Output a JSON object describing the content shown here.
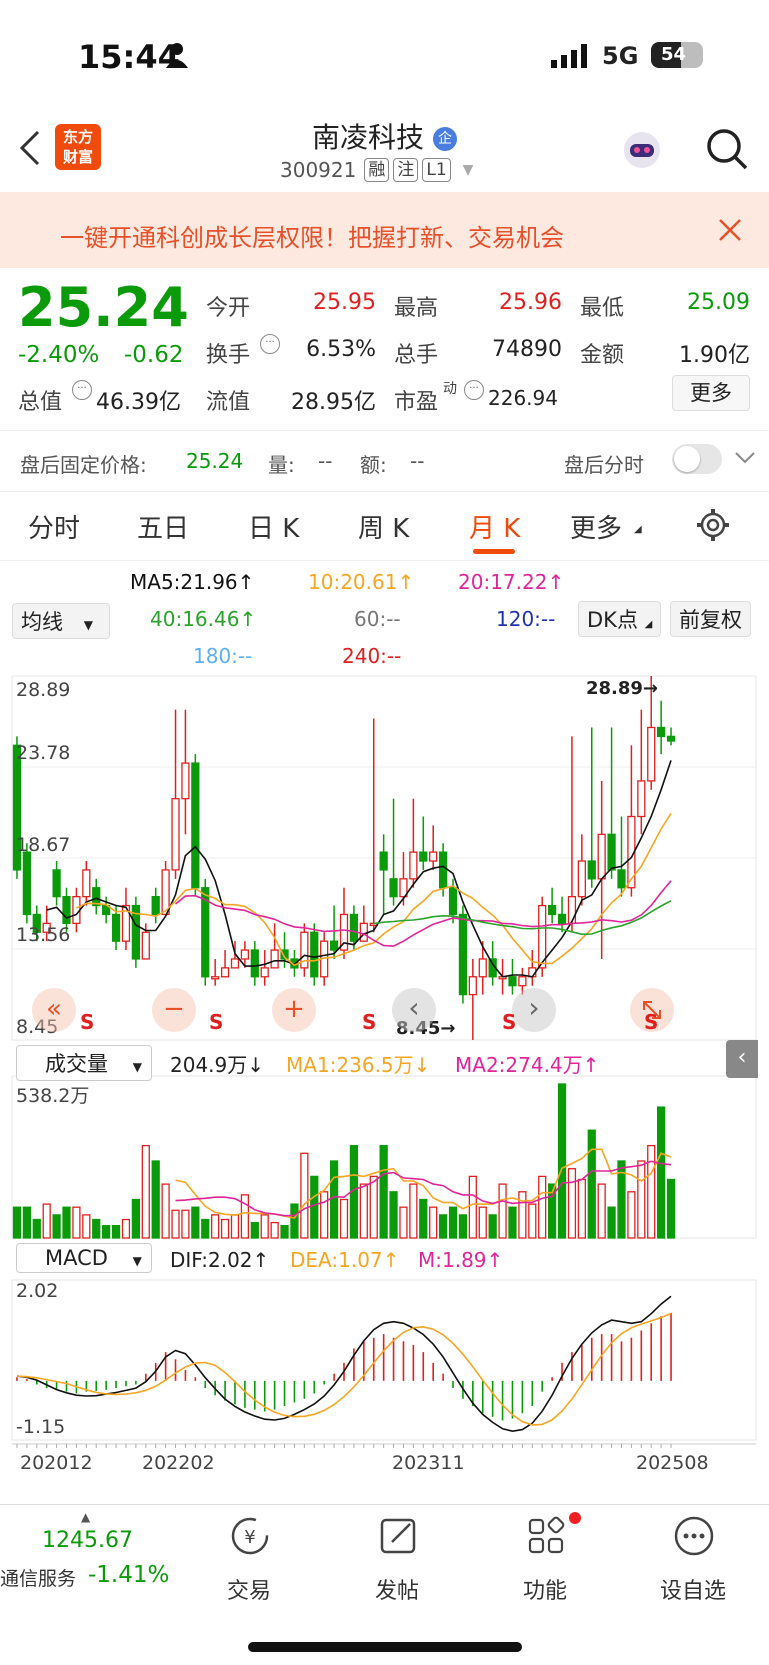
{
  "status_bar": {
    "time": "15:44",
    "network": "5G",
    "battery": "54"
  },
  "header": {
    "app_logo_line1": "东方",
    "app_logo_line2": "财富",
    "stock_name": "南凌科技",
    "enterprise_badge": "企",
    "stock_code": "300921",
    "tags": [
      "融",
      "注",
      "L1"
    ]
  },
  "banner": {
    "text": "一键开通科创成长层权限！把握打新、交易机会"
  },
  "quote": {
    "price": "25.24",
    "change_pct": "-2.40%",
    "change": "-0.62",
    "open_label": "今开",
    "open": "25.95",
    "high_label": "最高",
    "high": "25.96",
    "low_label": "最低",
    "low": "25.09",
    "turnover_label": "换手",
    "turnover": "6.53%",
    "volume_label": "总手",
    "volume": "74890",
    "amount_label": "金额",
    "amount": "1.90亿",
    "mktcap_label": "总值",
    "mktcap": "46.39亿",
    "float_label": "流值",
    "float_cap": "28.95亿",
    "pe_label": "市盈",
    "pe_sup": "动",
    "pe": "226.94",
    "more_label": "更多"
  },
  "after_hours": {
    "fixed_price_label": "盘后固定价格:",
    "fixed_price": "25.24",
    "vol_label": "量:",
    "vol": "--",
    "amt_label": "额:",
    "amt": "--",
    "timeshare_label": "盘后分时"
  },
  "tabs": [
    "分时",
    "五日",
    "日 K",
    "周 K",
    "月 K",
    "更多"
  ],
  "active_tab": "月 K",
  "ma_legend": {
    "ma5": "MA5:21.96↑",
    "ma10": "10:20.61↑",
    "ma20": "20:17.22↑",
    "ma40": "40:16.46↑",
    "ma60": "60:--",
    "ma120": "120:--",
    "ma180": "180:--",
    "ma240": "240:--",
    "ma_select": "均线",
    "dk_label": "DK点",
    "adjust_label": "前复权"
  },
  "colors": {
    "ma5": "#111111",
    "ma10": "#f5a623",
    "ma20": "#e0259a",
    "ma40": "#2aa32a",
    "ma120": "#2233aa",
    "ma180": "#5fb0f0",
    "ma240": "#e02020",
    "up": "#e02020",
    "down": "#0a9a0a",
    "accent": "#f04a0c"
  },
  "kchart": {
    "y_labels": [
      "28.89",
      "23.78",
      "18.67",
      "13.56",
      "8.45"
    ],
    "max_marker": "28.89→",
    "min_marker": "8.45→",
    "signal": "S",
    "controls": [
      "«",
      "−",
      "+",
      "‹",
      "›"
    ]
  },
  "volume_panel": {
    "select": "成交量",
    "value": "204.9万↓",
    "ma1": "MA1:236.5万↓",
    "ma2": "MA2:274.4万↑",
    "y_max": "538.2万"
  },
  "macd_panel": {
    "select": "MACD",
    "dif": "DIF:2.02↑",
    "dea": "DEA:1.07↑",
    "m": "M:1.89↑",
    "y_max": "2.02",
    "y_min": "-1.15"
  },
  "x_labels": [
    "202012",
    "202202",
    "202311",
    "202508"
  ],
  "bottom_bar": {
    "index_value": "1245.67",
    "index_name": "通信服务",
    "index_change": "-1.41%",
    "items": [
      "交易",
      "发帖",
      "功能",
      "设自选"
    ]
  },
  "chart_data": {
    "type": "candlestick",
    "title": "",
    "ylim": [
      8.45,
      28.89
    ],
    "open": [
      25.0,
      19.0,
      15.5,
      14.5,
      18.0,
      16.5,
      15.0,
      16.5,
      17.0,
      16.0,
      15.5,
      14.0,
      16.0,
      13.0,
      16.5,
      15.5,
      18.0,
      22.0,
      24.0,
      17.0,
      12.0,
      12.0,
      12.5,
      13.0,
      13.5,
      12.0,
      12.5,
      13.5,
      13.0,
      12.5,
      14.5,
      12.0,
      14.0,
      13.5,
      15.5,
      14.0,
      15.0,
      19.0,
      17.5,
      16.5,
      17.5,
      19.0,
      18.5,
      19.0,
      17.0,
      15.5,
      11.0,
      12.0,
      13.0,
      12.0,
      12.0,
      11.5,
      12.0,
      12.5,
      16.0,
      15.5,
      15.0,
      16.5,
      18.5,
      17.5,
      20.0,
      18.0,
      17.0,
      21.0,
      23.0,
      26.0,
      25.5
    ],
    "close": [
      18.0,
      15.5,
      14.5,
      15.0,
      16.5,
      15.0,
      16.5,
      18.0,
      16.0,
      15.5,
      14.0,
      16.0,
      13.0,
      14.5,
      15.5,
      18.0,
      22.0,
      24.0,
      17.0,
      12.0,
      12.0,
      12.5,
      13.0,
      13.5,
      12.0,
      12.5,
      13.5,
      13.0,
      12.5,
      14.5,
      12.0,
      14.0,
      13.5,
      15.5,
      14.0,
      15.0,
      15.0,
      18.0,
      16.5,
      17.5,
      19.0,
      18.5,
      19.0,
      17.0,
      15.5,
      11.0,
      12.0,
      13.0,
      12.0,
      12.0,
      11.5,
      12.0,
      12.5,
      16.0,
      15.5,
      15.0,
      16.5,
      18.5,
      17.5,
      20.0,
      18.0,
      17.0,
      21.0,
      23.0,
      26.0,
      25.5,
      25.24
    ],
    "high": [
      25.5,
      19.5,
      16.0,
      16.0,
      18.5,
      17.0,
      17.0,
      18.5,
      17.5,
      16.5,
      16.0,
      17.0,
      16.5,
      15.0,
      17.0,
      18.5,
      27.0,
      27.0,
      24.5,
      17.5,
      13.0,
      13.5,
      14.0,
      14.0,
      14.0,
      13.5,
      15.0,
      14.5,
      13.5,
      15.0,
      15.0,
      14.5,
      16.0,
      17.0,
      16.0,
      16.0,
      26.5,
      20.0,
      22.0,
      19.0,
      22.0,
      21.0,
      20.5,
      19.5,
      17.5,
      16.0,
      13.0,
      14.0,
      14.0,
      13.0,
      13.0,
      12.5,
      13.5,
      16.5,
      17.0,
      16.5,
      25.5,
      20.0,
      26.0,
      23.0,
      26.0,
      21.0,
      25.0,
      27.0,
      28.89,
      27.5,
      26.0
    ],
    "low": [
      17.5,
      15.0,
      14.0,
      14.0,
      16.0,
      14.5,
      14.5,
      16.0,
      15.5,
      15.0,
      13.5,
      13.5,
      12.5,
      14.0,
      15.0,
      15.5,
      17.5,
      20.0,
      16.5,
      11.5,
      11.5,
      12.0,
      12.5,
      12.5,
      11.5,
      11.5,
      12.5,
      12.5,
      12.0,
      12.0,
      11.5,
      11.5,
      13.0,
      13.0,
      13.5,
      14.0,
      14.5,
      15.5,
      16.0,
      16.0,
      17.0,
      18.0,
      18.0,
      16.5,
      15.0,
      10.5,
      8.45,
      11.0,
      11.5,
      11.0,
      11.0,
      11.0,
      11.5,
      12.0,
      15.0,
      14.5,
      14.5,
      16.0,
      17.0,
      13.0,
      17.5,
      16.5,
      16.5,
      20.0,
      22.5,
      24.5,
      25.0
    ],
    "volume_ratio": [
      0.2,
      0.2,
      0.12,
      0.22,
      0.15,
      0.2,
      0.2,
      0.15,
      0.12,
      0.08,
      0.08,
      0.12,
      0.25,
      0.6,
      0.5,
      0.35,
      0.18,
      0.18,
      0.2,
      0.12,
      0.15,
      0.12,
      0.15,
      0.28,
      0.1,
      0.15,
      0.1,
      0.08,
      0.22,
      0.55,
      0.4,
      0.3,
      0.5,
      0.25,
      0.6,
      0.35,
      0.4,
      0.6,
      0.3,
      0.2,
      0.35,
      0.25,
      0.2,
      0.15,
      0.2,
      0.15,
      0.4,
      0.2,
      0.15,
      0.35,
      0.2,
      0.3,
      0.22,
      0.4,
      0.35,
      1.0,
      0.45,
      0.38,
      0.7,
      0.35,
      0.2,
      0.5,
      0.3,
      0.5,
      0.6,
      0.85,
      0.38
    ],
    "macd_bar": [
      0.1,
      0.05,
      -0.1,
      -0.2,
      -0.25,
      -0.3,
      -0.35,
      -0.3,
      -0.28,
      -0.25,
      -0.2,
      -0.15,
      -0.1,
      0.2,
      0.5,
      0.8,
      0.6,
      0.3,
      0.1,
      -0.2,
      -0.4,
      -0.55,
      -0.65,
      -0.75,
      -0.8,
      -0.85,
      -0.8,
      -0.7,
      -0.6,
      -0.5,
      -0.35,
      -0.1,
      0.2,
      0.5,
      0.9,
      1.1,
      1.2,
      1.3,
      1.2,
      1.1,
      1.0,
      0.8,
      0.5,
      0.2,
      -0.2,
      -0.5,
      -0.7,
      -0.9,
      -1.0,
      -1.1,
      -1.05,
      -0.9,
      -0.7,
      -0.3,
      0.1,
      0.5,
      0.8,
      1.0,
      1.2,
      1.3,
      1.3,
      1.1,
      1.2,
      1.4,
      1.6,
      1.8,
      1.89
    ]
  }
}
